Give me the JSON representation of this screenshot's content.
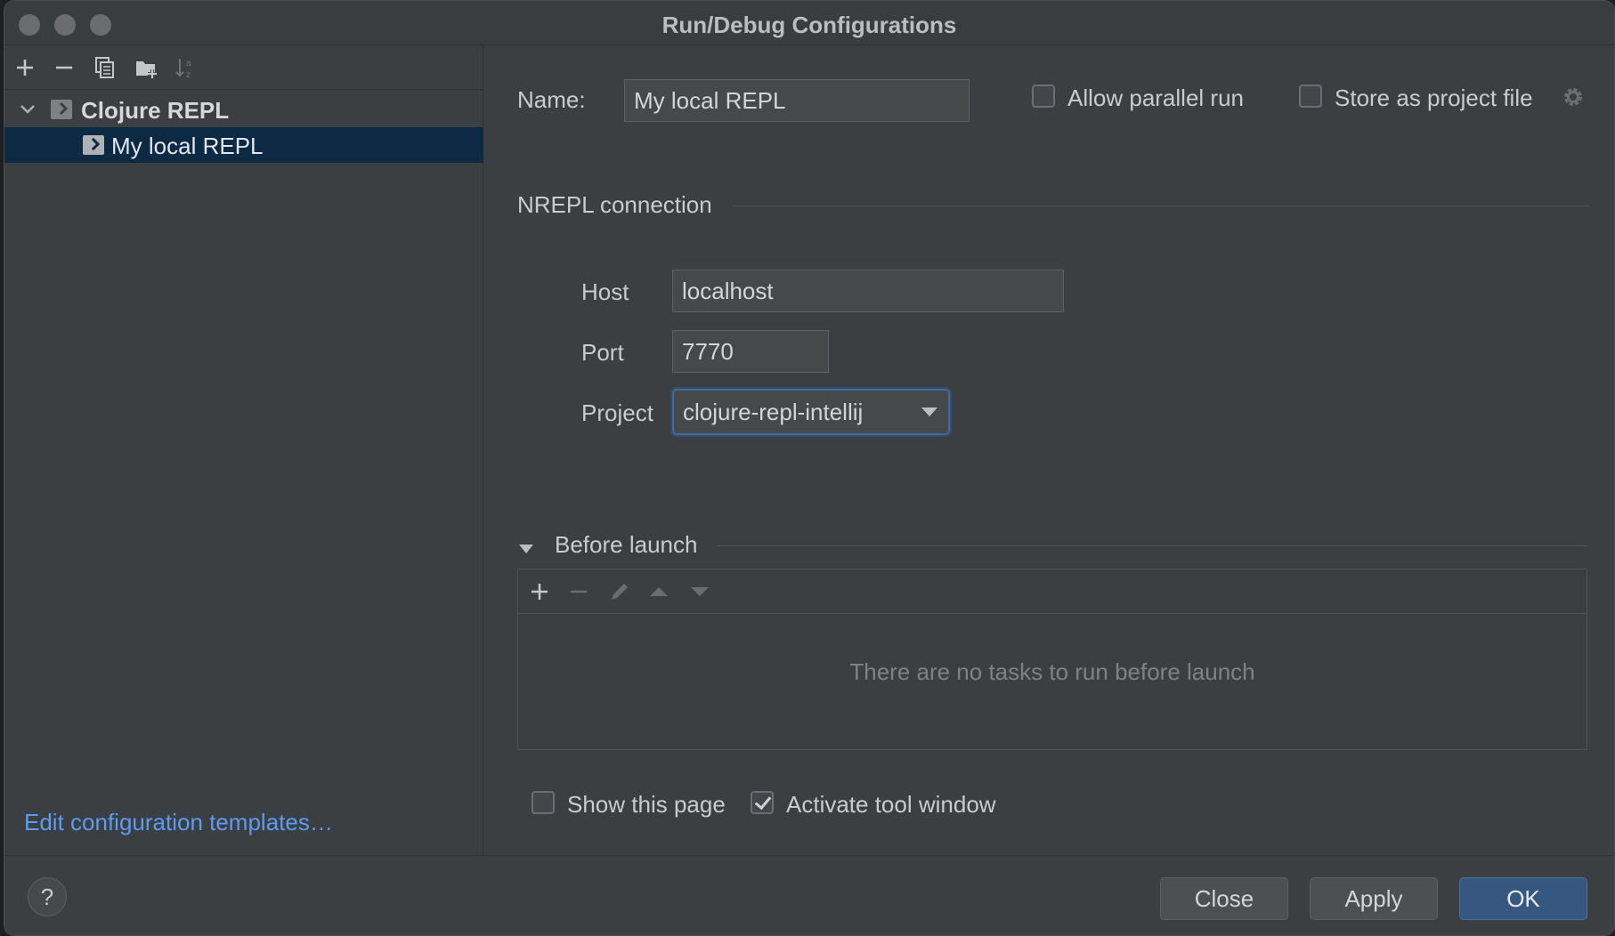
{
  "window": {
    "title": "Run/Debug Configurations"
  },
  "left_panel": {
    "toolbar_icons": [
      "add-icon",
      "remove-icon",
      "copy-icon",
      "folder-add-icon",
      "sort-icon"
    ],
    "tree": {
      "group_label": "Clojure REPL",
      "item_label": "My local REPL"
    },
    "edit_templates_link": "Edit configuration templates…"
  },
  "form": {
    "name_label": "Name:",
    "name_value": "My local REPL",
    "allow_parallel_run": {
      "label": "Allow parallel run",
      "checked": false
    },
    "store_as_project_file": {
      "label": "Store as project file",
      "checked": false
    },
    "nrepl_section_title": "NREPL connection",
    "host_label": "Host",
    "host_value": "localhost",
    "port_label": "Port",
    "port_value": "7770",
    "project_label": "Project",
    "project_value": "clojure-repl-intellij"
  },
  "before_launch": {
    "title": "Before launch",
    "empty_text": "There are no tasks to run before launch",
    "toolbar_icons": [
      "add-icon",
      "remove-icon",
      "edit-icon",
      "move-up-icon",
      "move-down-icon"
    ]
  },
  "footer_options": {
    "show_this_page": {
      "label": "Show this page",
      "checked": false
    },
    "activate_tool_window": {
      "label": "Activate tool window",
      "checked": true
    }
  },
  "buttons": {
    "help": "?",
    "close": "Close",
    "apply": "Apply",
    "ok": "OK"
  },
  "colors": {
    "background": "#3c3f41",
    "selection": "#0d2a45",
    "link": "#5b9cf0",
    "primary_button": "#365880"
  }
}
